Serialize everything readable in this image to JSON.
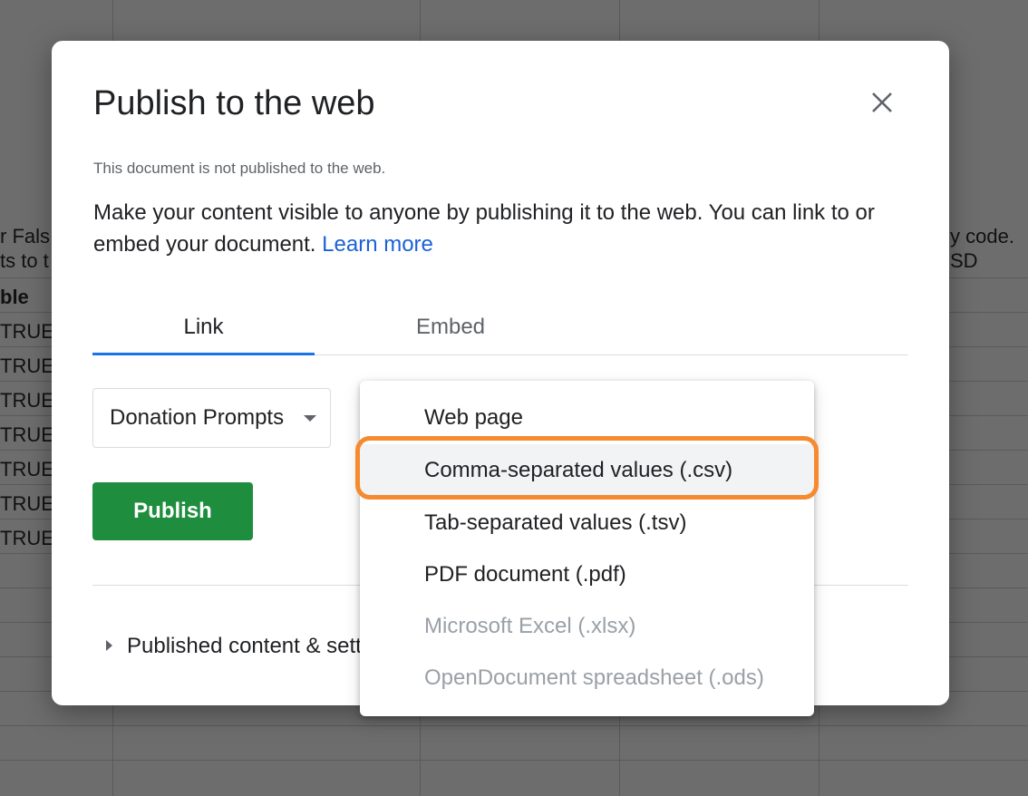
{
  "background_sheet": {
    "left_cells": [
      "r Fals",
      "ts to t",
      "ble",
      "TRUE",
      "TRUE",
      "TRUE",
      "TRUE",
      "TRUE",
      "TRUE",
      "TRUE"
    ],
    "right_cells": [
      "y code.",
      "SD"
    ]
  },
  "dialog": {
    "title": "Publish to the web",
    "status": "This document is not published to the web.",
    "description": "Make your content visible to anyone by publishing it to the web. You can link to or embed your document.",
    "learn_more": "Learn more",
    "tabs": [
      {
        "label": "Link",
        "active": true
      },
      {
        "label": "Embed",
        "active": false
      }
    ],
    "sheet_select_value": "Donation Prompts",
    "publish_label": "Publish",
    "expander_label": "Published content & settings"
  },
  "format_menu": {
    "items": [
      {
        "label": "Web page",
        "enabled": true
      },
      {
        "label": "Comma-separated values (.csv)",
        "enabled": true,
        "hovered": true
      },
      {
        "label": "Tab-separated values (.tsv)",
        "enabled": true
      },
      {
        "label": "PDF document (.pdf)",
        "enabled": true
      },
      {
        "label": "Microsoft Excel (.xlsx)",
        "enabled": false
      },
      {
        "label": "OpenDocument spreadsheet (.ods)",
        "enabled": false
      }
    ]
  },
  "colors": {
    "accent_blue": "#1a73e8",
    "publish_green": "#1e8e3e",
    "highlight_orange": "#f58a2e"
  }
}
